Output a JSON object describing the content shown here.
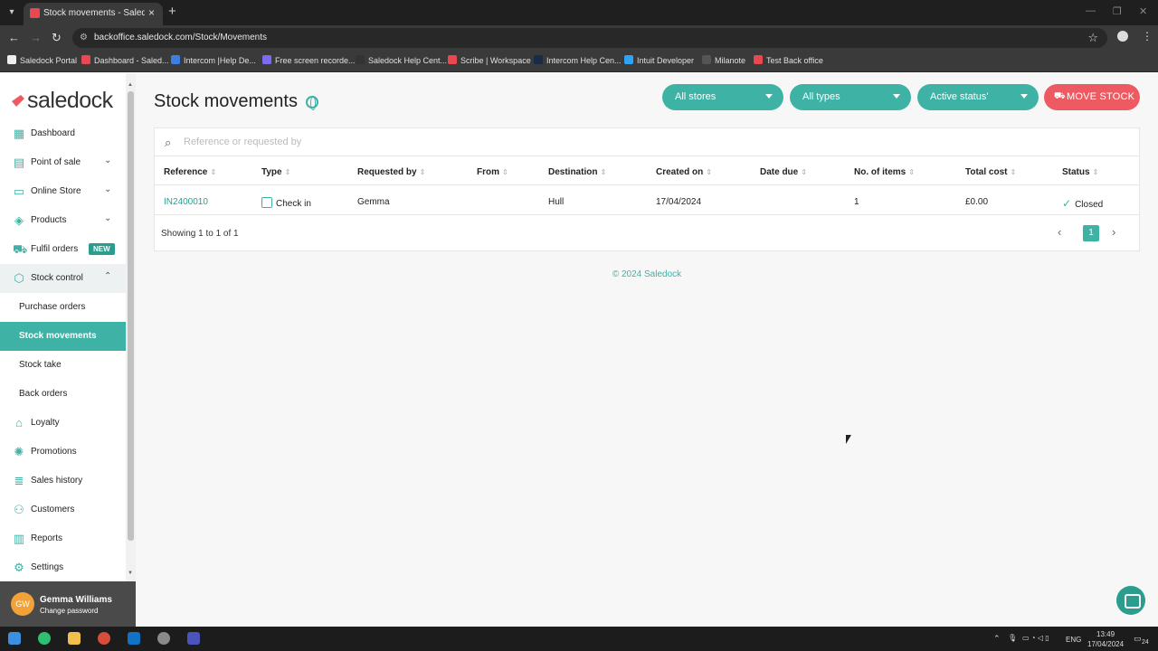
{
  "browser": {
    "tab_title": "Stock movements - Saledock b",
    "url": "backoffice.saledock.com/Stock/Movements",
    "bookmarks": [
      "Saledock Portal",
      "Dashboard - Saled...",
      "Intercom |Help De...",
      "Free screen recorde...",
      "Saledock Help Cent...",
      "Scribe | Workspace",
      "Intercom Help Cen...",
      "Intuit Developer",
      "Milanote",
      "Test Back office"
    ]
  },
  "sidebar": {
    "logo_text": "saledock",
    "items": [
      {
        "label": "Dashboard"
      },
      {
        "label": "Point of sale"
      },
      {
        "label": "Online Store"
      },
      {
        "label": "Products"
      },
      {
        "label": "Fulfil orders",
        "badge": "NEW"
      },
      {
        "label": "Stock control"
      },
      {
        "label": "Purchase orders"
      },
      {
        "label": "Stock movements"
      },
      {
        "label": "Stock take"
      },
      {
        "label": "Back orders"
      },
      {
        "label": "Loyalty"
      },
      {
        "label": "Promotions"
      },
      {
        "label": "Sales history"
      },
      {
        "label": "Customers"
      },
      {
        "label": "Reports"
      },
      {
        "label": "Settings"
      }
    ],
    "user": {
      "initials": "GW",
      "name": "Gemma Williams",
      "action": "Change password"
    }
  },
  "main": {
    "title": "Stock movements",
    "filters": [
      "All stores",
      "All types",
      "Active status'"
    ],
    "move_button": "MOVE STOCK",
    "search_placeholder": "Reference or requested by",
    "columns": [
      "Reference",
      "Type",
      "Requested by",
      "From",
      "Destination",
      "Created on",
      "Date due",
      "No. of items",
      "Total cost",
      "Status"
    ],
    "rows": [
      {
        "reference": "IN2400010",
        "type": "Check in",
        "requested_by": "Gemma",
        "from": "",
        "destination": "Hull",
        "created_on": "17/04/2024",
        "date_due": "",
        "items": "1",
        "total_cost": "£0.00",
        "status": "Closed"
      }
    ],
    "showing": "Showing 1 to 1 of 1",
    "current_page": "1",
    "footer": "© 2024 Saledock"
  },
  "taskbar": {
    "lang": "ENG",
    "time": "13:49",
    "date": "17/04/2024",
    "notifications": "24"
  },
  "colors": {
    "accent": "#3db2a5",
    "danger": "#ee5a62"
  }
}
